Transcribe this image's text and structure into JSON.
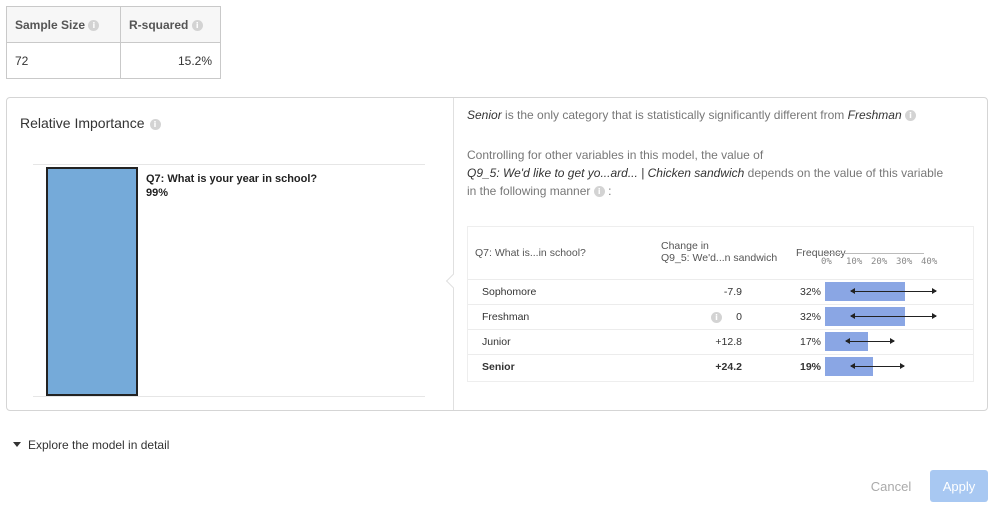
{
  "stats": {
    "sample_size_label": "Sample Size",
    "r_squared_label": "R-squared",
    "sample_size": "72",
    "r_squared": "15.2%"
  },
  "relative_importance": {
    "title": "Relative Importance",
    "variable": "Q7: What is your year in school?",
    "value_label": "99%",
    "value": 99
  },
  "summary": {
    "category": "Senior",
    "middle": " is the only category that is statistically significantly different from ",
    "reference": "Freshman"
  },
  "controlling": {
    "line1": "Controlling for other variables in this model, the value of",
    "outcome": "Q9_5: We'd like to get yo...ard... | Chicken sandwich",
    "line2_rest": " depends on the value of this variable",
    "line3": "in the following manner"
  },
  "table": {
    "col1": "Q7: What is...in school?",
    "col2_line1": "Change in",
    "col2_line2": "Q9_5: We'd...n sandwich",
    "col3": "Frequency",
    "rows": [
      {
        "category": "Sophomore",
        "change": "-7.9",
        "freq": "32%",
        "freq_value": 32,
        "ci": [
          10.5,
          44.5
        ],
        "bold": false,
        "info": false
      },
      {
        "category": "Freshman",
        "change": "0",
        "freq": "32%",
        "freq_value": 32,
        "ci": [
          10.5,
          44.5
        ],
        "bold": false,
        "info": true
      },
      {
        "category": "Junior",
        "change": "+12.8",
        "freq": "17%",
        "freq_value": 17,
        "ci": [
          8.5,
          27.5
        ],
        "bold": false,
        "info": false
      },
      {
        "category": "Senior",
        "change": "+24.2",
        "freq": "19%",
        "freq_value": 19,
        "ci": [
          10.5,
          31.5
        ],
        "bold": true,
        "info": false
      }
    ],
    "axis_ticks": [
      "0%",
      "10%",
      "20%",
      "30%",
      "40%"
    ],
    "bar_color": "#8aa6e4"
  },
  "explore_label": "Explore the model in detail",
  "buttons": {
    "cancel": "Cancel",
    "apply": "Apply"
  },
  "colors": {
    "importance_bar": "#75aad9",
    "apply_button": "#a8c8f2"
  }
}
